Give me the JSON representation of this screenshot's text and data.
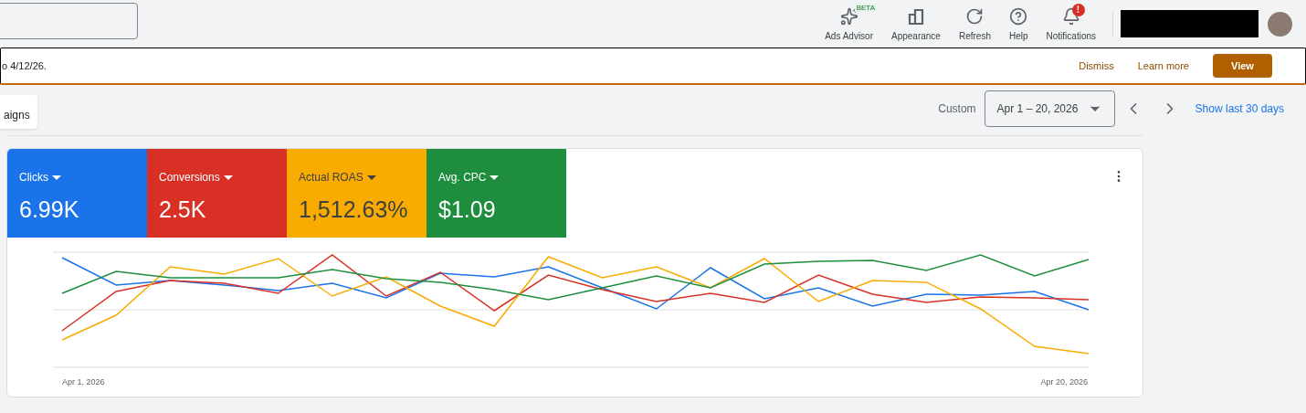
{
  "topbar": {
    "actions": [
      {
        "kind": "advisor",
        "label": "Ads Advisor",
        "badge": "BETA"
      },
      {
        "kind": "appearance",
        "label": "Appearance"
      },
      {
        "kind": "refresh",
        "label": "Refresh"
      },
      {
        "kind": "help",
        "label": "Help"
      },
      {
        "kind": "notifications",
        "label": "Notifications",
        "badge": "!"
      }
    ]
  },
  "banner": {
    "text": "o 4/12/26.",
    "actions": [
      "Dismiss",
      "Learn more"
    ],
    "primary": "View"
  },
  "tab": {
    "label": "aigns"
  },
  "date_range": {
    "label": "Custom",
    "value": "Apr 1 – 20, 2026",
    "link": "Show last 30 days"
  },
  "metrics": [
    {
      "label": "Clicks",
      "value": "6.99K",
      "color": "#1a73e8",
      "dark_text": false
    },
    {
      "label": "Conversions",
      "value": "2.5K",
      "color": "#d93025",
      "dark_text": false
    },
    {
      "label": "Actual ROAS",
      "value": "1,512.63%",
      "color": "#f9ab00",
      "dark_text": true
    },
    {
      "label": "Avg. CPC",
      "value": "$1.09",
      "color": "#1e8e3e",
      "dark_text": false
    }
  ],
  "chart": {
    "x_start": "Apr 1, 2026",
    "x_end": "Apr 20, 2026"
  }
}
